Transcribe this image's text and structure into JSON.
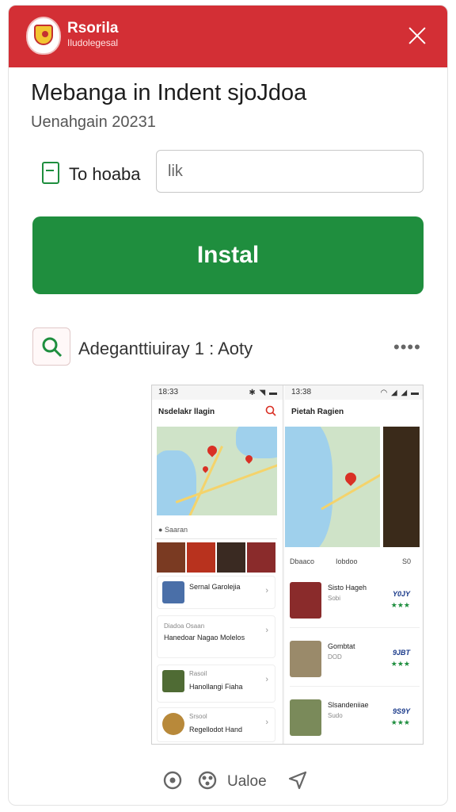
{
  "header": {
    "brand": "Rsorila",
    "brand_sub": "Iludolegesal",
    "accent": "#d32f35"
  },
  "page": {
    "title": "Mebanga in Indent sjoJdoa",
    "subtitle": "Uenahgain 20231"
  },
  "form": {
    "toggle_label": "To hoaba",
    "input_value": "lik",
    "install_label": "Instal",
    "install_color": "#1f8e3e"
  },
  "app_row": {
    "name": "Adeganttiuiray 1 : Aoty",
    "more": "••••"
  },
  "preview": {
    "left": {
      "time": "18:33",
      "title": "Nsdelakr llagin",
      "chip": "Saaran",
      "cards": [
        {
          "title": "Sernal Garolejia",
          "sub": ""
        },
        {
          "title": "Hanedoar Nagao Molelos",
          "sub": "Diadoa Osaan"
        },
        {
          "title": "Hanollangi Fiaha",
          "sub": "Rasoil"
        },
        {
          "title": "Regellodot Hand",
          "sub": "Srsool"
        }
      ]
    },
    "right": {
      "time": "13:38",
      "title": "Pietah Ragien",
      "tabs": [
        "Dbaaco",
        "Iobdoo",
        "S0"
      ],
      "items": [
        {
          "title": "Sisto Hageh",
          "sub": "Sobi",
          "price": "Y0JY",
          "stars": "★★★"
        },
        {
          "title": "Gombtat",
          "sub": "DOD",
          "price": "9JBT",
          "stars": "★★★"
        },
        {
          "title": "Slsandeniiae",
          "sub": "Sudo",
          "price": "9S9Y",
          "stars": "★★★"
        }
      ]
    }
  },
  "footer": {
    "label": "Ualoe"
  }
}
